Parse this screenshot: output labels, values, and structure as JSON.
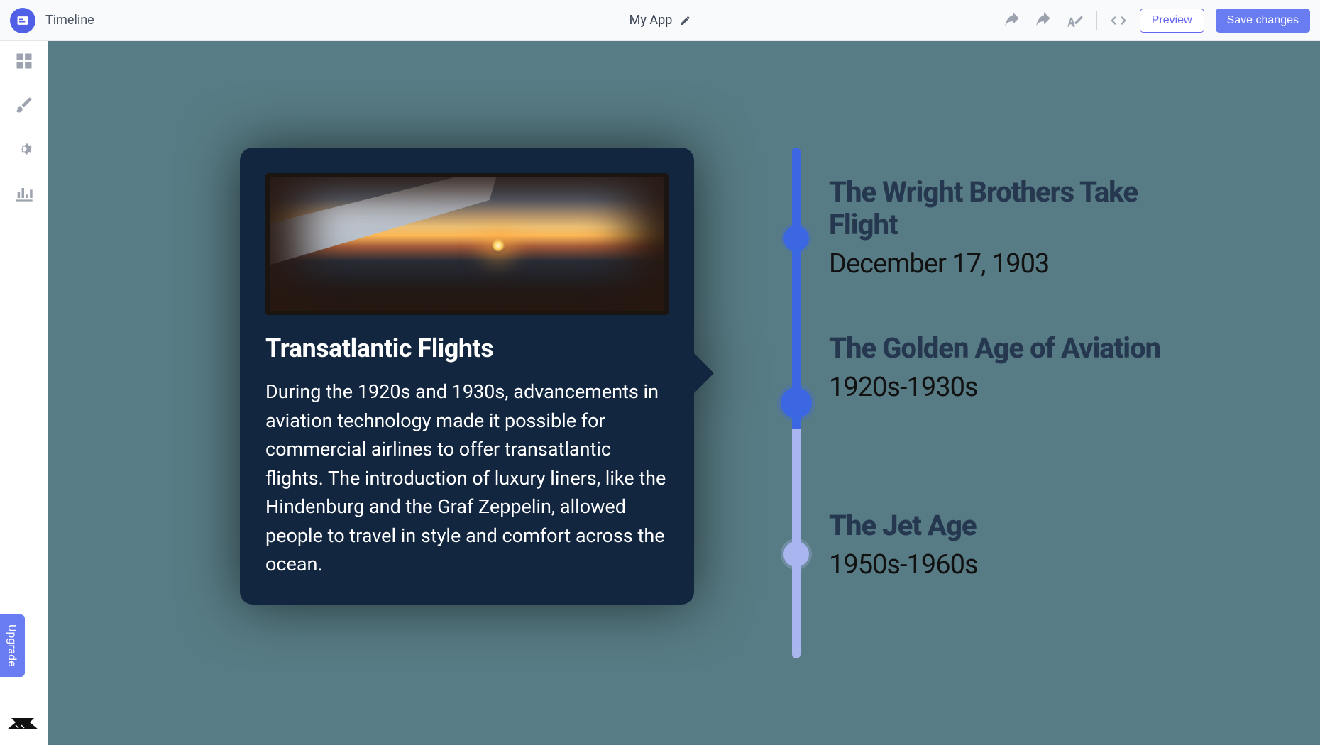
{
  "topbar": {
    "page_title": "Timeline",
    "app_name": "My App",
    "preview_label": "Preview",
    "save_label": "Save changes"
  },
  "leftrail": {
    "upgrade_label": "Upgrade"
  },
  "card": {
    "title": "Transatlantic Flights",
    "body": "During the 1920s and 1930s, advancements in aviation technology made it possible for commercial airlines to offer transatlantic flights. The introduction of luxury liners, like the Hindenburg and the Graf Zeppelin, allowed people to travel in style and comfort across the ocean."
  },
  "timeline": {
    "items": [
      {
        "title": "The Wright Brothers Take Flight",
        "date": "December 17, 1903"
      },
      {
        "title": "The Golden Age of Aviation",
        "date": "1920s-1930s"
      },
      {
        "title": "The Jet Age",
        "date": "1950s-1960s"
      }
    ]
  },
  "colors": {
    "accent": "#6a7cf2",
    "timeline_active": "#3b67e2",
    "timeline_inactive": "#a9b5ee",
    "canvas_bg": "#587c85",
    "card_bg": "#12263f"
  }
}
